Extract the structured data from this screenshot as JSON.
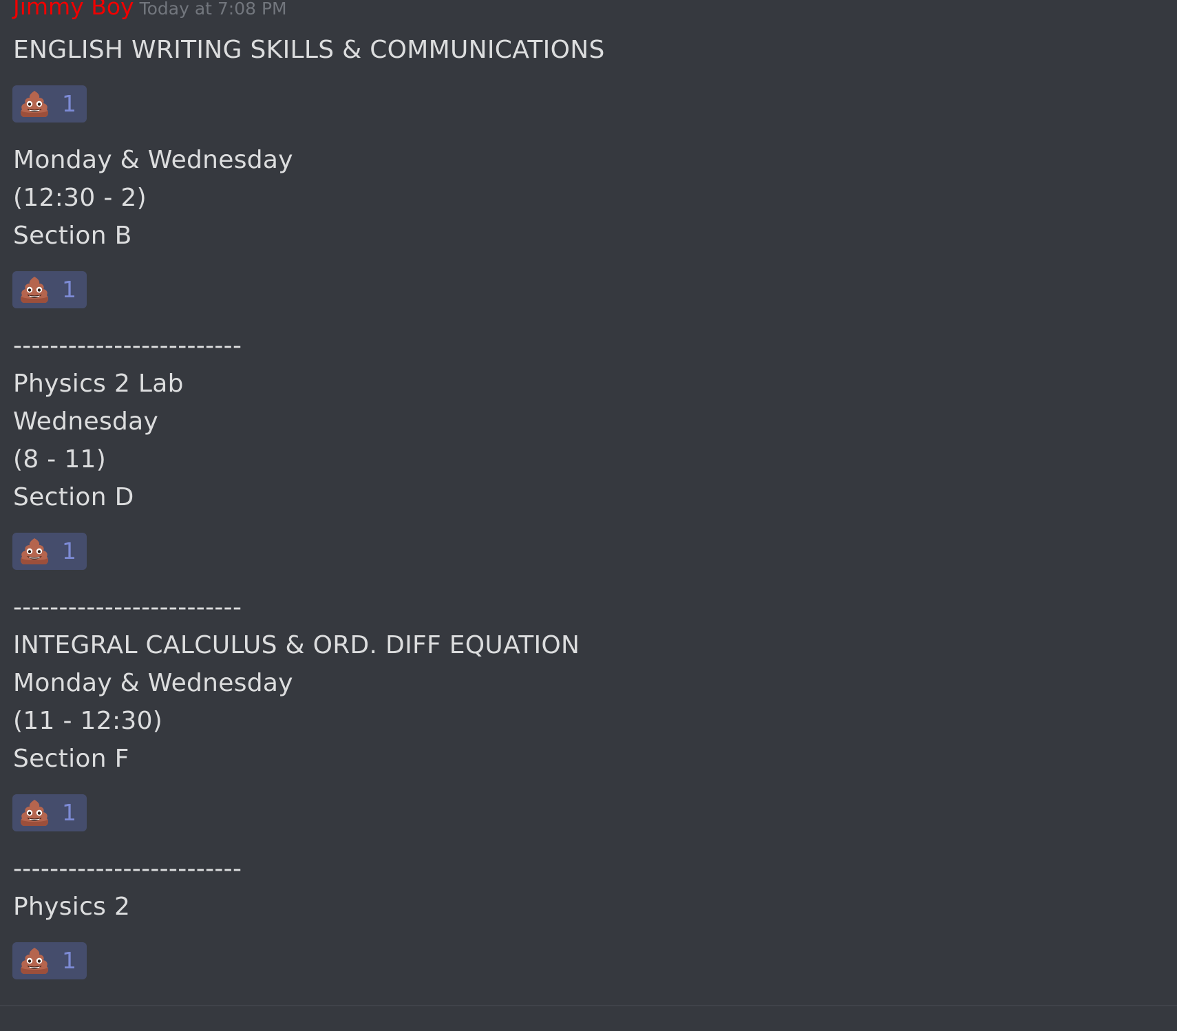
{
  "message": {
    "author": "Jimmy Boy",
    "timestamp": "Today at 7:08 PM",
    "author_color": "#f00000",
    "lines": [
      "ENGLISH WRITING SKILLS & COMMUNICATIONS",
      "Monday & Wednesday",
      "(12:30 - 2)",
      "Section B",
      "-------------------------",
      "Physics 2 Lab",
      "Wednesday",
      "(8 - 11)",
      "Section D",
      "-------------------------",
      "INTEGRAL CALCULUS & ORD. DIFF EQUATION",
      "Monday & Wednesday",
      "(11 - 12:30)",
      "Section F",
      "-------------------------",
      "Physics 2"
    ]
  },
  "reactions": [
    {
      "emoji": "pile-of-poo-icon",
      "count": "1"
    },
    {
      "emoji": "pile-of-poo-icon",
      "count": "1"
    },
    {
      "emoji": "pile-of-poo-icon",
      "count": "1"
    },
    {
      "emoji": "pile-of-poo-icon",
      "count": "1"
    },
    {
      "emoji": "pile-of-poo-icon",
      "count": "1"
    }
  ],
  "colors": {
    "background": "#36393f",
    "text": "#dcddde",
    "timestamp": "#72767d",
    "reaction_bg": "#454d6c",
    "reaction_count": "#7d8bd6"
  }
}
